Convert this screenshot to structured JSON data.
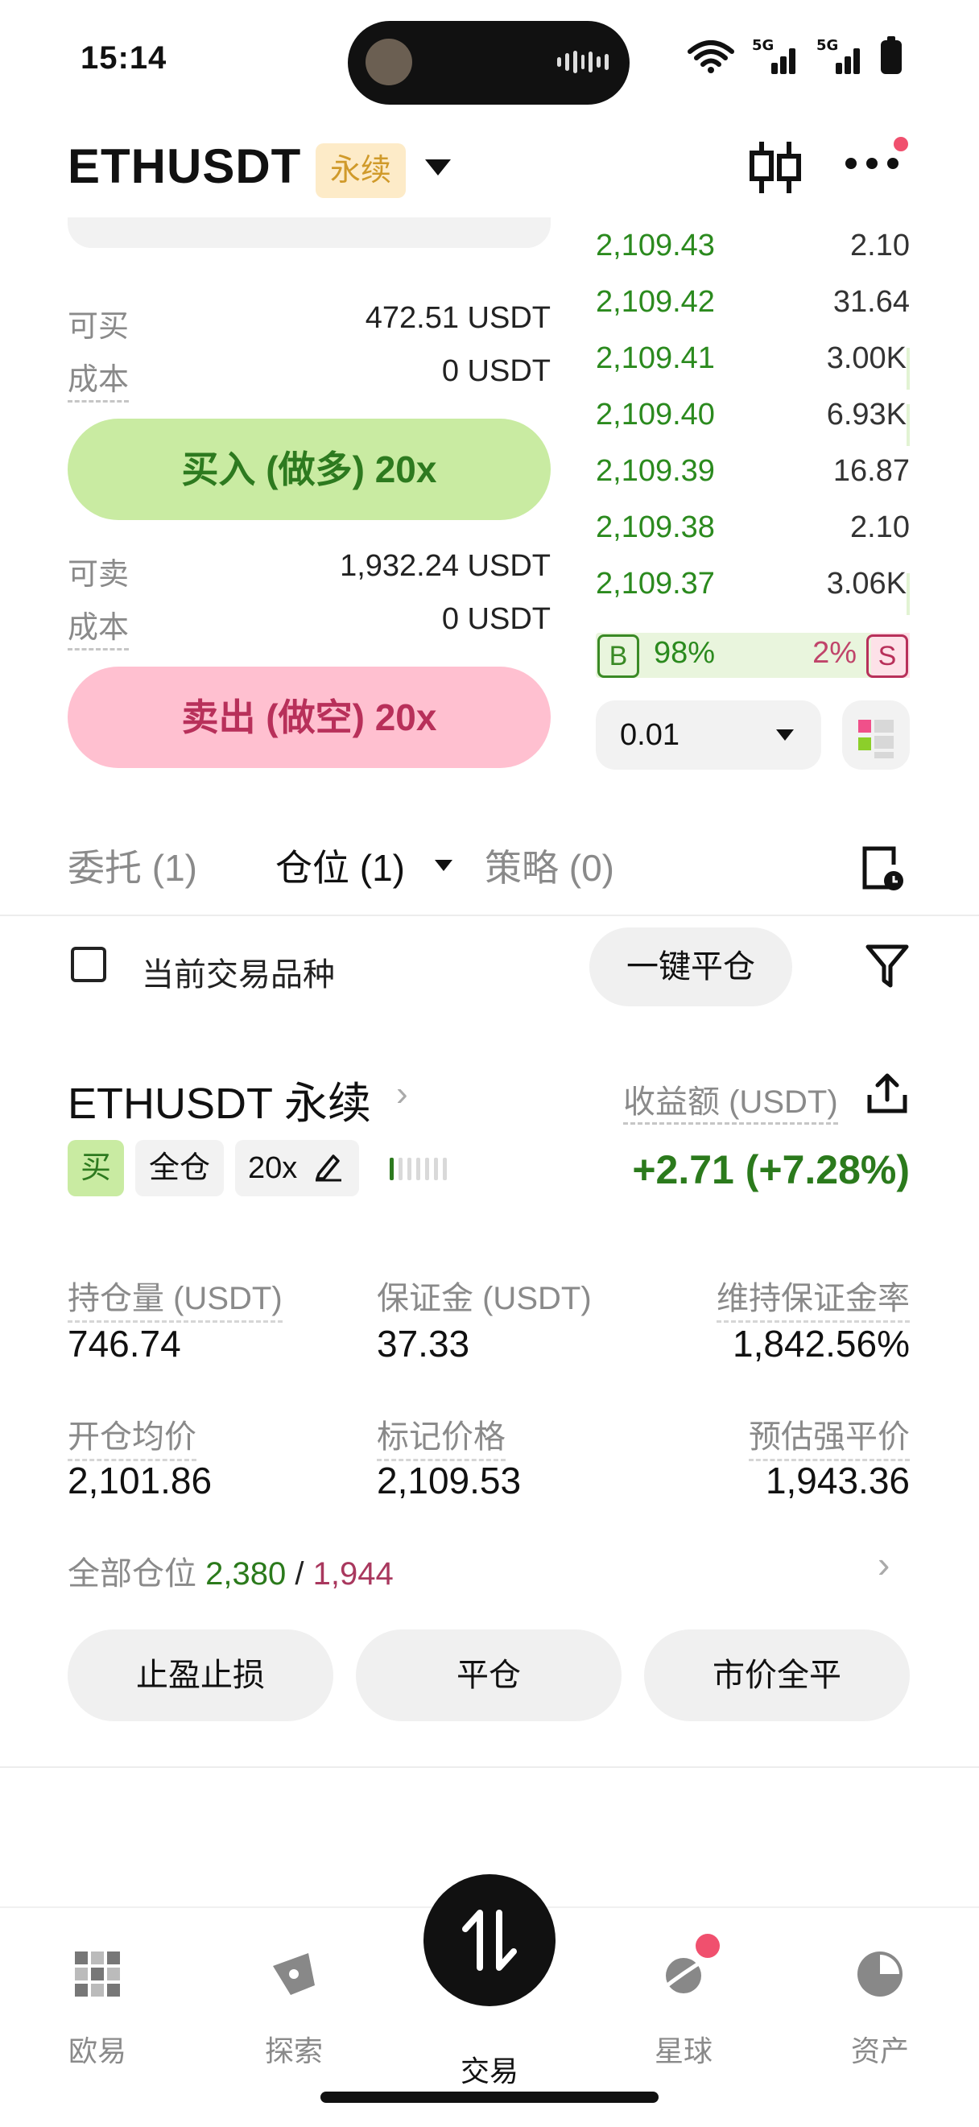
{
  "status_bar": {
    "time": "15:14",
    "net1": "5G",
    "net2": "5G"
  },
  "header": {
    "pair": "ETHUSDT",
    "contract_tag": "永续"
  },
  "order_form": {
    "buy_available_label": "可买",
    "buy_available_value": "472.51 USDT",
    "buy_cost_label": "成本",
    "buy_cost_value": "0 USDT",
    "buy_button": "买入 (做多) 20x",
    "sell_available_label": "可卖",
    "sell_available_value": "1,932.24 USDT",
    "sell_cost_label": "成本",
    "sell_cost_value": "0 USDT",
    "sell_button": "卖出 (做空) 20x"
  },
  "order_book": {
    "rows": [
      {
        "price": "2,109.43",
        "size": "2.10"
      },
      {
        "price": "2,109.42",
        "size": "31.64"
      },
      {
        "price": "2,109.41",
        "size": "3.00K"
      },
      {
        "price": "2,109.40",
        "size": "6.93K"
      },
      {
        "price": "2,109.39",
        "size": "16.87"
      },
      {
        "price": "2,109.38",
        "size": "2.10"
      },
      {
        "price": "2,109.37",
        "size": "3.06K"
      }
    ],
    "buy_tag": "B",
    "buy_ratio": "98%",
    "sell_ratio": "2%",
    "sell_tag": "S",
    "buy_ratio_fraction": 0.98,
    "step": "0.01"
  },
  "tabs": {
    "orders": "委托 (1)",
    "positions": "仓位 (1)",
    "strategies": "策略 (0)"
  },
  "filter_bar": {
    "current_pair_label": "当前交易品种",
    "close_all": "一键平仓"
  },
  "position": {
    "title": "ETHUSDT 永续",
    "pnl_label": "收益额 (USDT)",
    "side": "买",
    "margin_mode": "全仓",
    "leverage": "20x",
    "pnl_value": "+2.71 (+7.28%)",
    "stats": [
      {
        "label": "持仓量 (USDT)",
        "value": "746.74"
      },
      {
        "label": "保证金 (USDT)",
        "value": "37.33"
      },
      {
        "label": "维持保证金率",
        "value": "1,842.56%"
      },
      {
        "label": "开仓均价",
        "value": "2,101.86"
      },
      {
        "label": "标记价格",
        "value": "2,109.53"
      },
      {
        "label": "预估强平价",
        "value": "1,943.36"
      }
    ],
    "all_positions_label": "全部仓位",
    "all_positions_long": "2,380",
    "all_positions_sep": "/",
    "all_positions_short": "1,944",
    "buttons": {
      "tp_sl": "止盈止损",
      "close": "平仓",
      "market_close": "市价全平"
    }
  },
  "bottom_nav": {
    "items": [
      {
        "label": "欧易",
        "icon": "okx-logo-icon"
      },
      {
        "label": "探索",
        "icon": "compass-icon"
      },
      {
        "label": "交易",
        "icon": "trade-arrows-icon"
      },
      {
        "label": "星球",
        "icon": "planet-icon"
      },
      {
        "label": "资产",
        "icon": "pie-chart-icon"
      }
    ]
  },
  "colors": {
    "green": "#2b8a1e",
    "red": "#b8305a",
    "buy_bg": "#c9eba2",
    "sell_bg": "#ffc0d0",
    "badge": "#f0506e"
  }
}
